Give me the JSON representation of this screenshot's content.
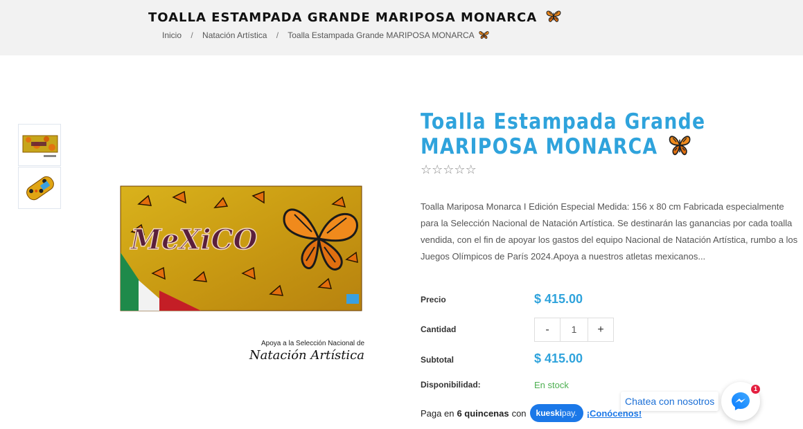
{
  "header": {
    "page_title": "TOALLA ESTAMPADA GRANDE MARIPOSA MONARCA",
    "breadcrumb": [
      {
        "label": "Inicio"
      },
      {
        "label": "Natación Artística"
      },
      {
        "label": "Toalla Estampada Grande MARIPOSA MONARCA"
      }
    ]
  },
  "gallery": {
    "image_caption_line1": "Apoya a la Selección Nacional de",
    "image_caption_line2": "Natación Artística",
    "towel_word": "MeXiCO"
  },
  "product": {
    "title": "Toalla Estampada Grande MARIPOSA MONARCA",
    "rating": 0,
    "rating_max": 5,
    "description": "Toalla Mariposa Monarca  I Edición Especial Medida: 156 x 80 cm Fabricada especialmente para la Selección Nacional de Natación Artística. Se destinarán las ganancias por cada toalla vendida, con el fin de apoyar los gastos del equipo Nacional de Natación Artística, rumbo a los  Juegos Olímpicos de París 2024.Apoya a nuestros atletas mexicanos...",
    "price_label": "Precio",
    "price": "$ 415.00",
    "quantity_label": "Cantidad",
    "quantity_minus": "-",
    "quantity_value": "1",
    "quantity_plus": "+",
    "subtotal_label": "Subtotal",
    "subtotal": "$ 415.00",
    "availability_label": "Disponibilidad:",
    "availability": "En stock"
  },
  "kueski": {
    "prefix": "Paga en",
    "installments": "6 quincenas",
    "connector": "con",
    "brand": "kueski",
    "brand_suffix": "pay.",
    "link": "¡Conócenos!"
  },
  "chat": {
    "label": "Chatea con nosotros",
    "badge_count": "1"
  },
  "colors": {
    "accent": "#2fa3dc",
    "stock_green": "#4caf50",
    "kueski_blue": "#1b78e8",
    "header_bg": "#f2f2f2"
  },
  "icons": {
    "title_icon": "butterfly-icon",
    "breadcrumb_icon": "butterfly-icon",
    "chat_icon": "messenger-icon",
    "rating_icon": "star-outline-icon"
  }
}
